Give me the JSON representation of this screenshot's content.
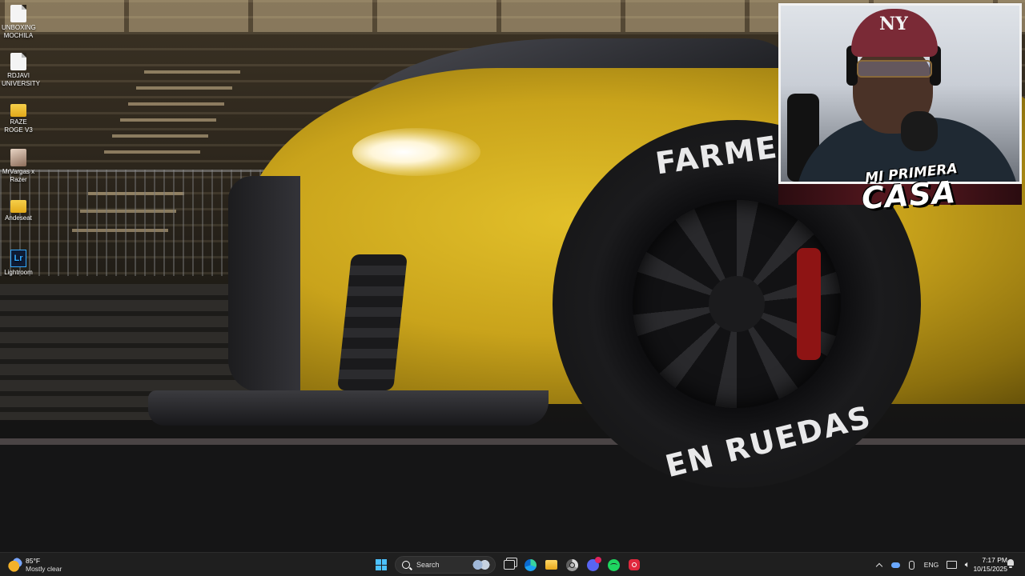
{
  "wallpaper": {
    "tire_text_top": "FARMEC",
    "tire_text_bottom": "EN RUEDAS"
  },
  "desktop_icons": [
    {
      "label": "UNBOXING MOCHILA",
      "icon": "document-icon"
    },
    {
      "label": "RDJAVI UNIVERSITY",
      "icon": "document-icon"
    },
    {
      "label": "RAZE ROGE V3",
      "icon": "folder-icon"
    },
    {
      "label": "MrVargas x Razer",
      "icon": "image-file-icon"
    },
    {
      "label": "Andeseat",
      "icon": "folder-icon"
    },
    {
      "label": "Lightroom",
      "icon": "lightroom-icon",
      "glyph": "Lr"
    }
  ],
  "webcam_overlay": {
    "cap_logo": "NY",
    "brand_line1": "MI PRIMERA",
    "brand_line2": "CASA"
  },
  "taskbar": {
    "weather": {
      "temp": "85°F",
      "desc": "Mostly clear"
    },
    "search_label": "Search",
    "discord_badge": "",
    "language": "ENG",
    "time": "7:17 PM",
    "date": "10/15/2025",
    "accent": "#4cc2ff"
  }
}
